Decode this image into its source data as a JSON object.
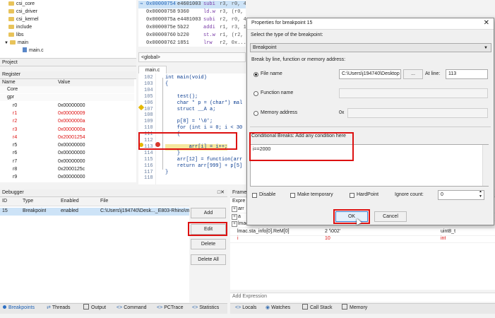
{
  "project_tree": {
    "items": [
      "csi_core",
      "csi_driver",
      "csi_kernel",
      "include",
      "libs",
      "main",
      "main.c"
    ],
    "panel_label": "Project"
  },
  "register": {
    "title": "Register",
    "col_name": "Name",
    "col_value": "Value",
    "rows": [
      {
        "name": "Core",
        "value": ""
      },
      {
        "name": "gpr",
        "value": ""
      },
      {
        "name": "r0",
        "value": "0x00000000"
      },
      {
        "name": "r1",
        "value": "0x00000009"
      },
      {
        "name": "r2",
        "value": "0x0000000a"
      },
      {
        "name": "r3",
        "value": "0x0000000a"
      },
      {
        "name": "r4",
        "value": "0x20001254"
      },
      {
        "name": "r5",
        "value": "0x00000000"
      },
      {
        "name": "r6",
        "value": "0x00000000"
      },
      {
        "name": "r7",
        "value": "0x00000000"
      },
      {
        "name": "r8",
        "value": "0x2000125c"
      },
      {
        "name": "r9",
        "value": "0x00000000"
      }
    ]
  },
  "disasm": {
    "rows": [
      {
        "addr": "0x00000754",
        "hex": "e4601003",
        "op": "subi",
        "args": "r3, r0, 4"
      },
      {
        "addr": "0x00000758",
        "hex": "9360",
        "op": "ld.w",
        "args": "r3, (r0, 0x0)"
      },
      {
        "addr": "0x0000075a",
        "hex": "e4481003",
        "op": "subi",
        "args": "r2, r0, 4"
      },
      {
        "addr": "0x0000075e",
        "hex": "5b22",
        "op": "addi",
        "args": "r1, r3, 1"
      },
      {
        "addr": "0x00000760",
        "hex": "b220",
        "op": "st.w",
        "args": "r1, (r2, 0x0)"
      },
      {
        "addr": "0x00000762",
        "hex": "1851",
        "op": "lrw",
        "args": "r2, 0x..."
      }
    ],
    "scope": "<global>"
  },
  "editor": {
    "tab": "main.c",
    "lines": [
      {
        "n": "102",
        "text": "int main(void)"
      },
      {
        "n": "103",
        "text": "{"
      },
      {
        "n": "104",
        "text": ""
      },
      {
        "n": "105",
        "text": "    test();"
      },
      {
        "n": "106",
        "text": "    char * p = (char*) mal"
      },
      {
        "n": "107",
        "text": "    struct __A a;"
      },
      {
        "n": "108",
        "text": ""
      },
      {
        "n": "109",
        "text": "    p[8] = '\\0';"
      },
      {
        "n": "110",
        "text": "    for (int i = 0; i < 30"
      },
      {
        "n": "111",
        "text": "    {"
      },
      {
        "n": "112",
        "text": ""
      },
      {
        "n": "113",
        "text": "        arr[i] = i++;"
      },
      {
        "n": "114",
        "text": "    }"
      },
      {
        "n": "115",
        "text": "    arr[12] = function(arr"
      },
      {
        "n": "116",
        "text": "    return arr[999] + p[5]"
      },
      {
        "n": "117",
        "text": "}"
      },
      {
        "n": "118",
        "text": ""
      }
    ]
  },
  "debugger": {
    "title": "Debugger",
    "headers": [
      "ID",
      "Type",
      "Enabled",
      "File"
    ],
    "rows": [
      {
        "id": "15",
        "type": "Breakpoint",
        "enabled": "enabled",
        "file": "C:\\Users\\j194740\\Desk..._E803-Rhino\\m"
      }
    ],
    "buttons": {
      "add": "Add",
      "edit": "Edit",
      "delete": "Delete",
      "delete_all": "Delete All"
    }
  },
  "watch": {
    "frame_label": "Frame",
    "expr_label": "Expre",
    "rows": [
      {
        "expr": "arr",
        "value": "",
        "type": ""
      },
      {
        "expr": "a",
        "value": "",
        "type": ""
      },
      {
        "expr": "lmac",
        "value": "",
        "type": ""
      },
      {
        "expr": "lmac.sta_info[0].ReM[0]",
        "value": "2 '\\002'",
        "type": "uint8_t"
      },
      {
        "expr": "i",
        "value": "10",
        "type": "int"
      }
    ],
    "add_expression": "Add Expression"
  },
  "bottom_tabs_left": [
    "Breakpoints",
    "Threads",
    "Output",
    "Command",
    "PCTrace",
    "Statistics"
  ],
  "bottom_tabs_right": [
    "Locals",
    "Watches",
    "Call Stack",
    "Memory"
  ],
  "dialog": {
    "title": "Properties for breakpoint 15",
    "select_type_label": "Select the type of the breakpoint:",
    "type_value": "Breakpoint",
    "break_by_label": "Break by line, function or memory address:",
    "file_name_label": "File name",
    "file_path": "C:\\Users\\j194740\\Desktop",
    "browse": "...",
    "at_line_label": "At line:",
    "line_value": "113",
    "function_name_label": "Function name",
    "memory_address_label": "Memory address",
    "addr_prefix": "0x",
    "cond_label": "Conditional Breaks: Add any condition here",
    "cond_value": "i==2000",
    "disable_label": "Disable",
    "make_temp_label": "Make temporary",
    "hardpoint_label": "HardPoint",
    "ignore_count_label": "Ignore count:",
    "ignore_count_value": "0",
    "ok": "OK",
    "cancel": "Cancel"
  },
  "colors": {
    "accent_red": "#d11111",
    "highlight_red": "#e02020",
    "select_blue": "#cde3f7"
  }
}
